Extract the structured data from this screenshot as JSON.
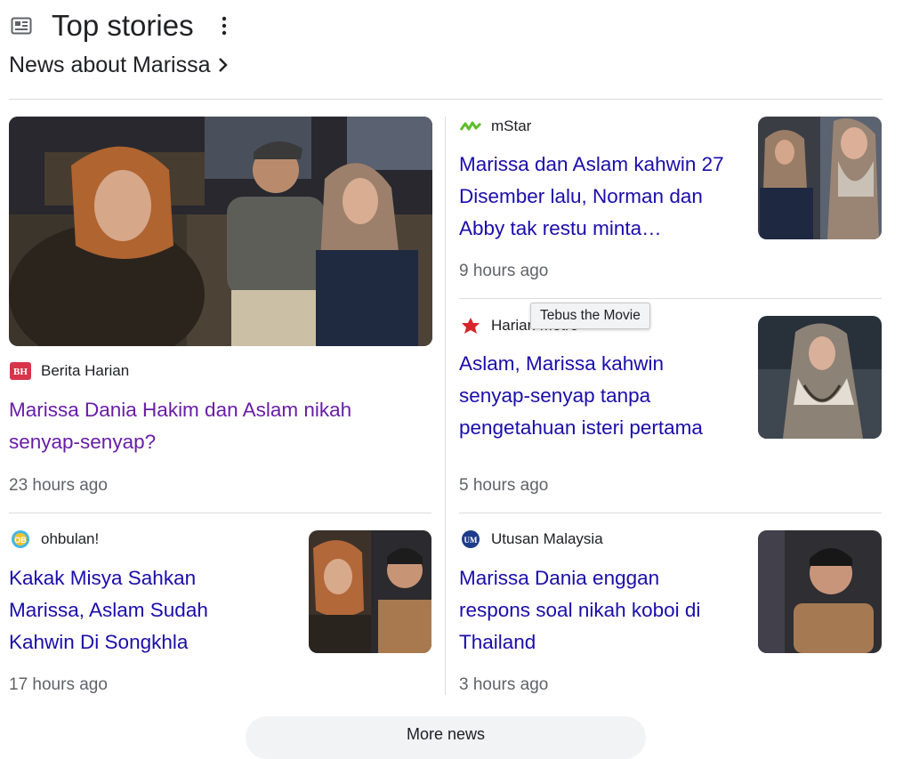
{
  "header": {
    "title": "Top stories",
    "subtitle": "News about Marissa"
  },
  "stories": [
    {
      "source": "Berita Harian",
      "source_logo": "bh-logo",
      "title": "Marissa Dania Hakim dan Aslam nikah senyap-senyap?",
      "time": "23 hours ago"
    },
    {
      "source": "mStar",
      "source_logo": "mstar-logo",
      "title": "Marissa dan Aslam kahwin 27 Disember lalu, Norman dan Abby tak restu minta…",
      "time": "9 hours ago"
    },
    {
      "source": "Harian Metro",
      "source_logo": "harian-metro-logo",
      "title": "Aslam, Marissa kahwin senyap-senyap tanpa pengetahuan isteri pertama",
      "time": "5 hours ago"
    },
    {
      "source": "ohbulan!",
      "source_logo": "ohbulan-logo",
      "title": "Kakak Misya Sahkan Marissa, Aslam Sudah Kahwin Di Songkhla",
      "time": "17 hours ago"
    },
    {
      "source": "Utusan Malaysia",
      "source_logo": "utusan-logo",
      "title": "Marissa Dania enggan respons soal nikah koboi di Thailand",
      "time": "3 hours ago"
    }
  ],
  "tooltip": "Tebus the Movie",
  "more_button": "More news",
  "colors": {
    "link": "#1a0dab",
    "visited": "#681da8",
    "meta": "#5f6368",
    "divider": "#dadce0"
  }
}
